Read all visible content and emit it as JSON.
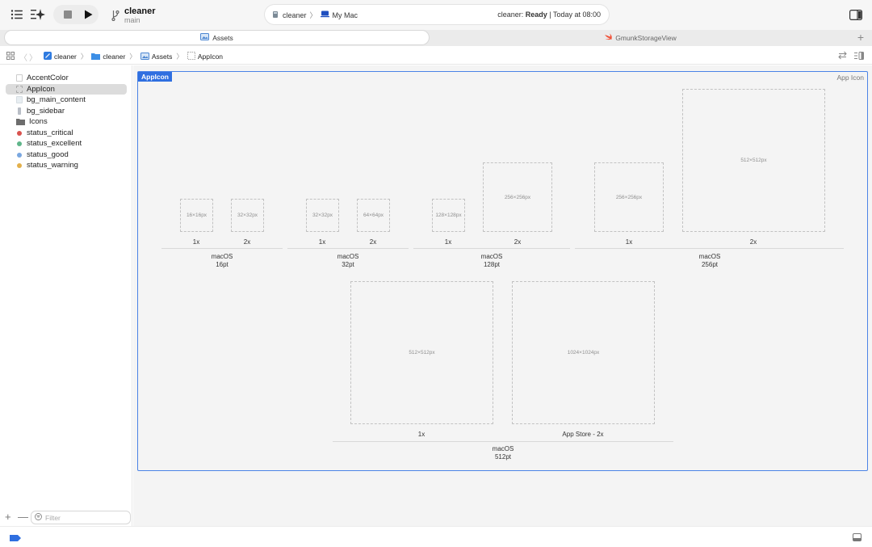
{
  "toolbar": {
    "scheme_name": "cleaner",
    "branch": "main",
    "destination_scheme": "cleaner",
    "destination_device": "My Mac",
    "status_prefix": "cleaner: ",
    "status_state": "Ready",
    "status_suffix": " | Today at 08:00"
  },
  "tabs": [
    {
      "label": "Assets",
      "active": true
    },
    {
      "label": "GmunkStorageView",
      "active": false
    }
  ],
  "breadcrumb": [
    "cleaner",
    "cleaner",
    "Assets",
    "AppIcon"
  ],
  "sidebar": {
    "items": [
      {
        "label": "AccentColor",
        "kind": "color",
        "color": "#ffffff"
      },
      {
        "label": "AppIcon",
        "kind": "appicon",
        "selected": true
      },
      {
        "label": "bg_main_content",
        "kind": "color",
        "color": "#e8eef2"
      },
      {
        "label": "bg_sidebar",
        "kind": "color",
        "color": "#c9ccd2"
      },
      {
        "label": "Icons",
        "kind": "folder"
      },
      {
        "label": "status_critical",
        "kind": "dot",
        "color": "#d9534f"
      },
      {
        "label": "status_excellent",
        "kind": "dot",
        "color": "#5fb58a"
      },
      {
        "label": "status_good",
        "kind": "dot",
        "color": "#7aa7e0"
      },
      {
        "label": "status_warning",
        "kind": "dot",
        "color": "#e3b04b"
      }
    ],
    "filter_placeholder": "Filter"
  },
  "editor": {
    "set_name": "AppIcon",
    "set_type": "App Icon",
    "groups": [
      {
        "platform": "macOS",
        "size": "16pt",
        "slots": [
          {
            "px": "16×16px",
            "scale": "1x"
          },
          {
            "px": "32×32px",
            "scale": "2x"
          }
        ]
      },
      {
        "platform": "macOS",
        "size": "32pt",
        "slots": [
          {
            "px": "32×32px",
            "scale": "1x"
          },
          {
            "px": "64×64px",
            "scale": "2x"
          }
        ]
      },
      {
        "platform": "macOS",
        "size": "128pt",
        "slots": [
          {
            "px": "128×128px",
            "scale": "1x"
          },
          {
            "px": "256×256px",
            "scale": "2x"
          }
        ]
      },
      {
        "platform": "macOS",
        "size": "256pt",
        "slots": [
          {
            "px": "256×256px",
            "scale": "1x"
          },
          {
            "px": "512×512px",
            "scale": "2x"
          }
        ]
      },
      {
        "platform": "macOS",
        "size": "512pt",
        "slots": [
          {
            "px": "512×512px",
            "scale": "1x"
          },
          {
            "px": "1024×1024px",
            "scale": "App Store - 2x"
          }
        ]
      }
    ]
  },
  "colors": {
    "accent": "#2f6fe0",
    "selection": "#dcdcdc"
  }
}
